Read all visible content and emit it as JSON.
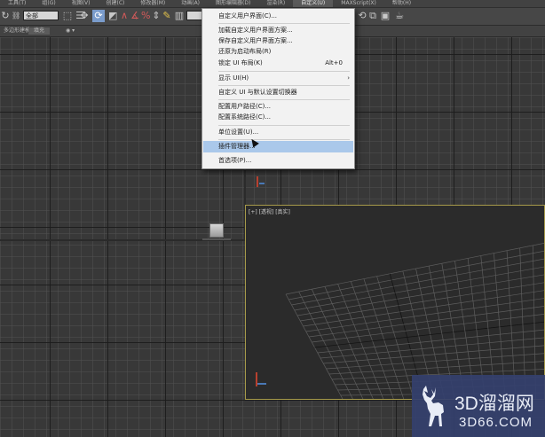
{
  "menubar": {
    "items": [
      {
        "label": "工具(T)"
      },
      {
        "label": "组(G)"
      },
      {
        "label": "视图(V)"
      },
      {
        "label": "创建(C)"
      },
      {
        "label": "修改器(M)"
      },
      {
        "label": "动画(A)"
      },
      {
        "label": "图形编辑器(D)"
      },
      {
        "label": "渲染(R)"
      },
      {
        "label": "自定义(U)"
      },
      {
        "label": "MAXScript(X)"
      },
      {
        "label": "帮助(H)"
      }
    ]
  },
  "toolbar": {
    "selection_filter": "全部",
    "view_field": "视图"
  },
  "ribbon": {
    "left_label": "多边形建模",
    "tab_label": "填充",
    "dropdown_label": "◉ ▾"
  },
  "viewports": {
    "perspective_label": "[+] [透视] [真实]"
  },
  "dropdown": {
    "items": [
      {
        "label": "自定义用户界面(C)..."
      },
      {
        "label": "加载自定义用户界面方案..."
      },
      {
        "label": "保存自定义用户界面方案..."
      },
      {
        "label": "还原为启动布局(R)"
      },
      {
        "label": "锁定 UI 布局(K)",
        "shortcut": "Alt+0"
      },
      {
        "label": "显示 UI(H)",
        "submenu": "›"
      },
      {
        "label": "自定义 UI 与默认设置切换器"
      },
      {
        "label": "配置用户路径(C)..."
      },
      {
        "label": "配置系统路径(C)..."
      },
      {
        "label": "单位设置(U)..."
      },
      {
        "label": "插件管理器..."
      },
      {
        "label": "首选项(P)..."
      }
    ],
    "highlighted_index": 10
  },
  "watermark": {
    "brand_cn": "3D溜溜网",
    "brand_url": "3D66.COM"
  },
  "colors": {
    "menu_highlight": "#aac8ea",
    "viewport_active_border": "#a69a4a",
    "watermark_bg": "#34406e"
  }
}
